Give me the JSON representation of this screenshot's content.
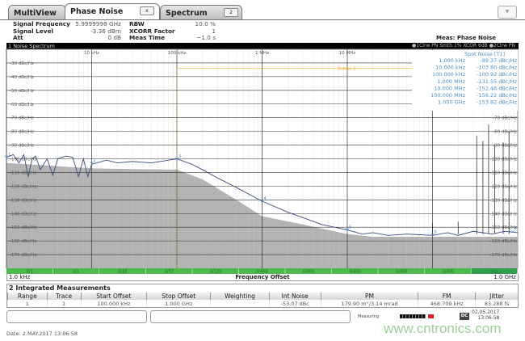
{
  "tabs": [
    {
      "label": "MultiView"
    },
    {
      "label": "Phase Noise",
      "button": "x"
    },
    {
      "label": "Spectrum",
      "button": "2"
    }
  ],
  "menu_button": "▼",
  "info": {
    "rows": [
      {
        "label": "Signal Frequency",
        "value": "5.9999998 GHz",
        "label2": "RBW",
        "value2": "10.0 %"
      },
      {
        "label": "Signal Level",
        "value": "-3.36 dBm",
        "label2": "XCORR Factor",
        "value2": "1"
      },
      {
        "label": "Att",
        "value": "0 dB",
        "label2": "Meas Time",
        "value2": "~1.0 s"
      }
    ],
    "meas": "Meas: Phase Noise"
  },
  "panel": {
    "title": "1 Noise Spectrum",
    "trace_info": "●1Clrw PN Smth 1% XCOR 6dB ●2Clrw PN"
  },
  "spot_noise": {
    "title": "Spot Noise [T1]",
    "rows": [
      {
        "offset": "1.000 kHz",
        "value": "-99.37 dBc/Hz"
      },
      {
        "offset": "10.000 kHz",
        "value": "-103.80 dBc/Hz"
      },
      {
        "offset": "100.000 kHz",
        "value": "-100.92 dBc/Hz"
      },
      {
        "offset": "1.000 MHz",
        "value": "-131.55 dBc/Hz"
      },
      {
        "offset": "10.000 MHz",
        "value": "-152.46 dBc/Hz"
      },
      {
        "offset": "100.000 MHz",
        "value": "-156.22 dBc/Hz"
      },
      {
        "offset": "1.000 GHz",
        "value": "-153.82 dBc/Hz"
      }
    ]
  },
  "range_label": "Range 1",
  "chart_data": {
    "type": "line",
    "xscale": "log",
    "xlim": [
      1000,
      1000000000
    ],
    "ylim": [
      -180,
      -20
    ],
    "grid": true,
    "xlabel": "Frequency Offset",
    "xstart": "1.0 kHz",
    "xstop": "1.0 GHz",
    "xticks": [
      {
        "f": 10000,
        "label": "10 kHz"
      },
      {
        "f": 100000,
        "label": "100 kHz"
      },
      {
        "f": 1000000,
        "label": "1 MHz"
      },
      {
        "f": 10000000,
        "label": "10 MHz"
      }
    ],
    "yticks_left": [
      -30,
      -40,
      -50,
      -60,
      -70,
      -80,
      -90,
      -100,
      -110,
      -120,
      -130,
      -140,
      -150,
      -160,
      -170
    ],
    "yticks_right": [
      -70,
      -80,
      -90,
      -100,
      -110,
      -120,
      -130,
      -140,
      -150,
      -160,
      -170
    ],
    "yunit": "dBc/Hz",
    "trace": [
      [
        1000,
        -99
      ],
      [
        1200,
        -97
      ],
      [
        1400,
        -103
      ],
      [
        1600,
        -97
      ],
      [
        1800,
        -113
      ],
      [
        2000,
        -100
      ],
      [
        2200,
        -98
      ],
      [
        2500,
        -108
      ],
      [
        3000,
        -100
      ],
      [
        3500,
        -112
      ],
      [
        4000,
        -100
      ],
      [
        5000,
        -98
      ],
      [
        6000,
        -99
      ],
      [
        7000,
        -113
      ],
      [
        8000,
        -100
      ],
      [
        9000,
        -113
      ],
      [
        10000,
        -104
      ],
      [
        15000,
        -101
      ],
      [
        20000,
        -103
      ],
      [
        30000,
        -102
      ],
      [
        50000,
        -103
      ],
      [
        80000,
        -101
      ],
      [
        100000,
        -100
      ],
      [
        150000,
        -104
      ],
      [
        200000,
        -108
      ],
      [
        300000,
        -114
      ],
      [
        500000,
        -121
      ],
      [
        1000000,
        -131
      ],
      [
        2000000,
        -139
      ],
      [
        5000000,
        -148
      ],
      [
        10000000,
        -152
      ],
      [
        15000000,
        -155
      ],
      [
        20000000,
        -154
      ],
      [
        30000000,
        -156
      ],
      [
        50000000,
        -155
      ],
      [
        100000000,
        -156
      ],
      [
        150000000,
        -154
      ],
      [
        200000000,
        -156
      ],
      [
        300000000,
        -153
      ],
      [
        500000000,
        -155
      ],
      [
        700000000,
        -153
      ],
      [
        1000000000,
        -154
      ]
    ],
    "spurs": [
      [
        100000000,
        -147
      ],
      [
        200000000,
        -146
      ],
      [
        330000000,
        -83
      ],
      [
        390000000,
        -87
      ],
      [
        455000000,
        -75
      ],
      [
        537000000,
        -90
      ],
      [
        675000000,
        -88
      ],
      [
        790000000,
        -80
      ]
    ],
    "floor": [
      [
        1000,
        -103
      ],
      [
        10000,
        -107
      ],
      [
        100000,
        -108
      ],
      [
        200000,
        -115
      ],
      [
        500000,
        -130
      ],
      [
        1000000,
        -142
      ],
      [
        3000000,
        -148
      ],
      [
        10000000,
        -155
      ],
      [
        20000000,
        -157
      ],
      [
        1000000000,
        -157
      ]
    ],
    "markers": [
      {
        "label": "1",
        "f": 1000,
        "v": -99.37
      },
      {
        "label": "2",
        "f": 10000,
        "v": -103.8
      },
      {
        "label": "3",
        "f": 100000,
        "v": -100.92
      },
      {
        "label": "4",
        "f": 1000000,
        "v": -131.55
      },
      {
        "label": "5",
        "f": 10000000,
        "v": -152.46
      },
      {
        "label": "6",
        "f": 100000000,
        "v": -156.22
      },
      {
        "label": "7",
        "f": 1000000000,
        "v": -153.82
      }
    ],
    "range": {
      "start": 100000,
      "stop": 1000000000,
      "level": -34
    }
  },
  "segments": [
    "0/1",
    "0/1",
    "0/10",
    "0/37",
    "0/128",
    "0/400",
    "0/400",
    "0/400",
    "0/400",
    "0/400",
    "1/1"
  ],
  "integrated": {
    "title": "2 Integrated Measurements",
    "headers": [
      "Range",
      "Trace",
      "Start Offset",
      "Stop Offset",
      "Weighting",
      "Int Noise",
      "PM",
      "FM",
      "Jitter"
    ],
    "rows": [
      [
        "1",
        "1",
        "100.000 kHz",
        "1.000 GHz",
        "",
        "-53.07 dBc",
        "179.90 m°/3.14 mrad",
        "468.709 kHz",
        "83.288 fs"
      ]
    ]
  },
  "status": {
    "measuring": "Measuring",
    "date": "02.05.2017",
    "time": "13:06:58",
    "dc": "DC"
  },
  "footer_date": "Date: 2.MAY.2017  13:06:58",
  "watermark": "www.cntronics.com",
  "colors": {
    "trace": "#3a4f7a",
    "floor": "#b3b3b3",
    "marker": "#4a90c8",
    "range": "#f5b030",
    "segment": "#4cba4c"
  }
}
